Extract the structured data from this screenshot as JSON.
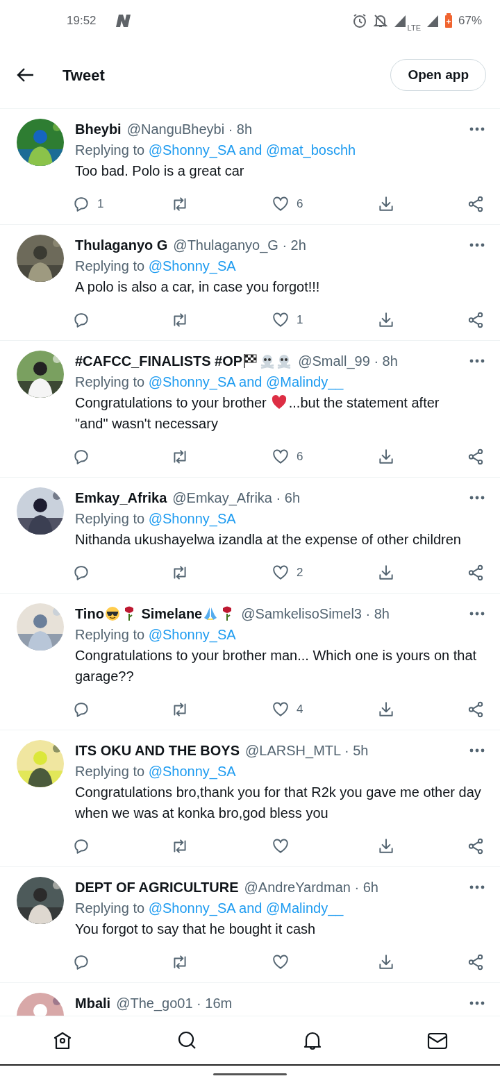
{
  "status_bar": {
    "time": "19:52",
    "network": "LTE",
    "battery": "67%"
  },
  "header": {
    "title": "Tweet",
    "button": "Open app"
  },
  "tweets": [
    {
      "name_parts": [
        {
          "text": "Bheybi"
        }
      ],
      "meta": "@NanguBheybi · 8h",
      "reply_prefix": "Replying to",
      "reply_to": "@Shonny_SA and @mat_boschh",
      "body": "Too bad. Polo is a great car",
      "replies": "1",
      "likes": "6"
    },
    {
      "name_parts": [
        {
          "text": "Thulaganyo G"
        }
      ],
      "meta": "@Thulaganyo_G · 2h",
      "reply_prefix": "Replying to",
      "reply_to": "@Shonny_SA",
      "body": "A polo is also a car, in case you forgot!!!",
      "likes": "1"
    },
    {
      "name_parts": [
        {
          "text": "#CAFCC_FINALISTS #OP"
        },
        {
          "kind": "flag"
        },
        {
          "kind": "skull"
        },
        {
          "kind": "skull"
        }
      ],
      "meta": "@Small_99 · 8h",
      "reply_prefix": "Replying to",
      "reply_to": "@Shonny_SA and @Malindy__",
      "body_lines": [
        [
          {
            "text": "Congratulations to your brother"
          },
          {
            "kind": "heart"
          },
          {
            "text": "...but the statement after"
          }
        ],
        [
          {
            "text": "\"and\" wasn't necessary"
          }
        ]
      ],
      "likes": "6"
    },
    {
      "name_parts": [
        {
          "text": "Emkay_Afrika"
        }
      ],
      "meta": "@Emkay_Afrika · 6h",
      "reply_prefix": "Replying to",
      "reply_to": "@Shonny_SA",
      "body": "Nithanda ukushayelwa izandla at the expense of other children",
      "likes": "2"
    },
    {
      "name_parts": [
        {
          "text": "Tino"
        },
        {
          "kind": "sunglasses"
        },
        {
          "kind": "rose"
        },
        {
          "text": " Simelane"
        },
        {
          "kind": "pray"
        },
        {
          "kind": "rose"
        }
      ],
      "meta": "@SamkelisoSimel3 · 8h",
      "reply_prefix": "Replying to",
      "reply_to": "@Shonny_SA",
      "body": "Congratulations to your brother man... Which one is yours on that garage??",
      "likes": "4"
    },
    {
      "name_parts": [
        {
          "text": "ITS OKU AND THE BOYS"
        }
      ],
      "meta": "@LARSH_MTL · 5h",
      "reply_prefix": "Replying to",
      "reply_to": "@Shonny_SA",
      "body": "Congratulations bro,thank you for that R2k you gave me other day when we was at konka bro,god bless you"
    },
    {
      "name_parts": [
        {
          "text": "DEPT OF AGRICULTURE"
        }
      ],
      "meta": "@AndreYardman · 6h",
      "reply_prefix": "Replying to",
      "reply_to": "@Shonny_SA and @Malindy__",
      "body": "You forgot to say that he bought it cash"
    },
    {
      "name_parts": [
        {
          "text": "Mbali"
        }
      ],
      "meta": "@The_go01 · 16m"
    }
  ]
}
